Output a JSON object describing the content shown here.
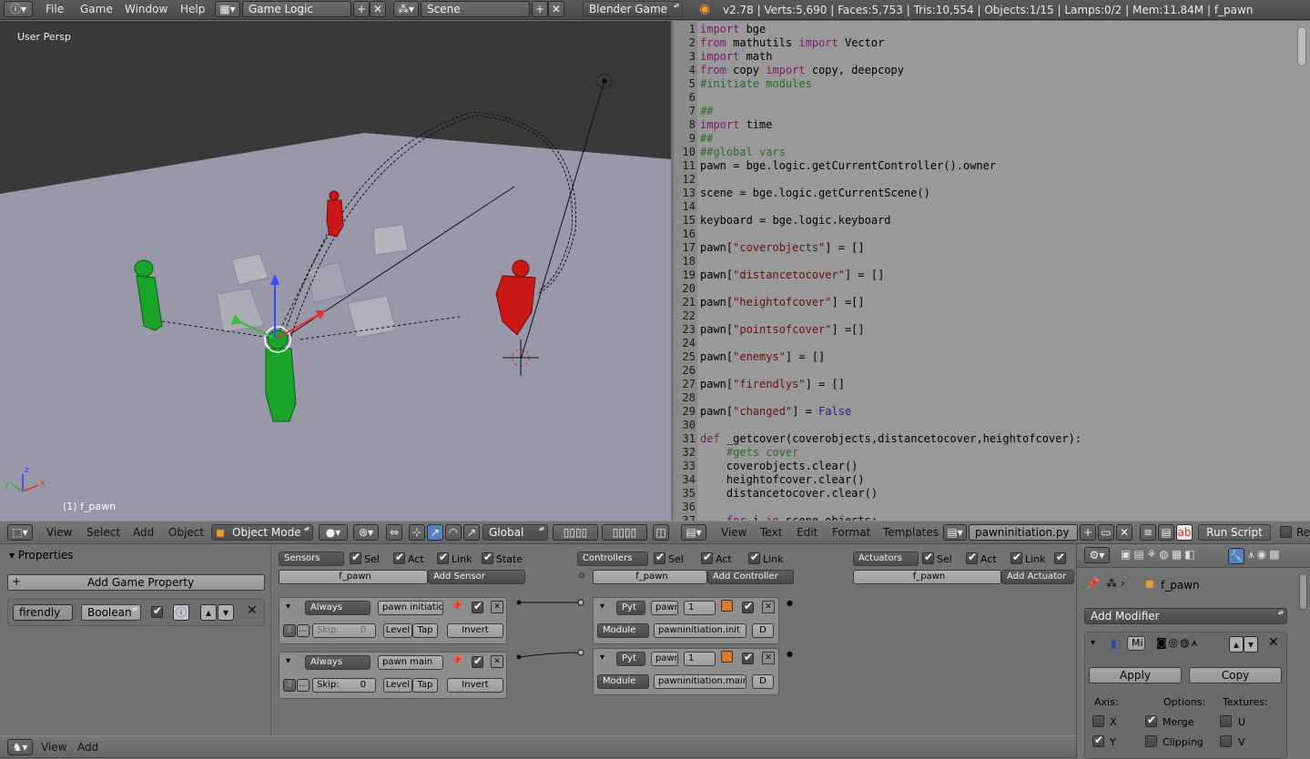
{
  "topbar": {
    "menus": [
      "File",
      "Game",
      "Window",
      "Help"
    ],
    "screen_layout": "Game Logic",
    "scene": "Scene",
    "engine": "Blender Game",
    "status": "v2.78 | Verts:5,690 | Faces:5,753 | Tris:10,554 | Objects:1/15 | Lamps:0/2 | Mem:11.84M | f_pawn"
  },
  "viewport": {
    "view_label": "User Persp",
    "object_label": "(1) f_pawn",
    "axis_labels": {
      "x": "x",
      "y": "y",
      "z": "z"
    },
    "header": {
      "menus": [
        "View",
        "Select",
        "Add",
        "Object"
      ],
      "mode": "Object Mode",
      "orientation": "Global"
    }
  },
  "text_editor": {
    "lines": [
      {
        "n": "1",
        "t": "import bge"
      },
      {
        "n": "2",
        "t": "from mathutils import Vector"
      },
      {
        "n": "3",
        "t": "import math"
      },
      {
        "n": "4",
        "t": "from copy import copy, deepcopy"
      },
      {
        "n": "5",
        "t": "#initiate modules"
      },
      {
        "n": "6",
        "t": ""
      },
      {
        "n": "7",
        "t": "##"
      },
      {
        "n": "8",
        "t": "import time"
      },
      {
        "n": "9",
        "t": "##"
      },
      {
        "n": "10",
        "t": "##global vars"
      },
      {
        "n": "11",
        "t": "pawn = bge.logic.getCurrentController().owner"
      },
      {
        "n": "12",
        "t": ""
      },
      {
        "n": "13",
        "t": "scene = bge.logic.getCurrentScene()"
      },
      {
        "n": "14",
        "t": ""
      },
      {
        "n": "15",
        "t": "keyboard = bge.logic.keyboard"
      },
      {
        "n": "16",
        "t": ""
      },
      {
        "n": "17",
        "t": "pawn[\"coverobjects\"] = []"
      },
      {
        "n": "18",
        "t": ""
      },
      {
        "n": "19",
        "t": "pawn[\"distancetocover\"] = []"
      },
      {
        "n": "20",
        "t": ""
      },
      {
        "n": "21",
        "t": "pawn[\"heightofcover\"] =[]"
      },
      {
        "n": "22",
        "t": ""
      },
      {
        "n": "23",
        "t": "pawn[\"pointsofcover\"] =[]"
      },
      {
        "n": "24",
        "t": ""
      },
      {
        "n": "25",
        "t": "pawn[\"enemys\"] = []"
      },
      {
        "n": "26",
        "t": ""
      },
      {
        "n": "27",
        "t": "pawn[\"firendlys\"] = []"
      },
      {
        "n": "28",
        "t": ""
      },
      {
        "n": "29",
        "t": "pawn[\"changed\"] = False"
      },
      {
        "n": "30",
        "t": ""
      },
      {
        "n": "31",
        "t": "def _getcover(coverobjects,distancetocover,heightofcover):"
      },
      {
        "n": "32",
        "t": "    #gets cover"
      },
      {
        "n": "33",
        "t": "    coverobjects.clear()"
      },
      {
        "n": "34",
        "t": "    heightofcover.clear()"
      },
      {
        "n": "35",
        "t": "    distancetocover.clear()"
      },
      {
        "n": "36",
        "t": ""
      },
      {
        "n": "37",
        "t": "    for i in scene.objects:"
      }
    ],
    "header": {
      "menus": [
        "View",
        "Text",
        "Edit",
        "Format",
        "Templates"
      ],
      "filename": "pawninitiation.py",
      "run_script": "Run Script",
      "trailing": "Re"
    }
  },
  "properties": {
    "title": "Properties",
    "add_button": "Add Game Property",
    "prop_name": "firendly",
    "prop_type": "Boolean"
  },
  "logic": {
    "sensors": {
      "menu": "Sensors",
      "sel": "Sel",
      "act": "Act",
      "link": "Link",
      "state": "State",
      "object": "f_pawn",
      "add": "Add Sensor"
    },
    "controllers": {
      "menu": "Controllers",
      "sel": "Sel",
      "act": "Act",
      "link": "Link",
      "object": "f_pawn",
      "add": "Add Controller"
    },
    "actuators": {
      "menu": "Actuators",
      "sel": "Sel",
      "act": "Act",
      "link": "Link",
      "object": "f_pawn",
      "add": "Add Actuator"
    },
    "sensor_bricks": [
      {
        "type": "Always",
        "name": "pawn initiation",
        "skip_label": "Skip:",
        "skip": "0",
        "level": "Level",
        "tap": "Tap",
        "invert": "Invert"
      },
      {
        "type": "Always",
        "name": "pawn main",
        "skip_label": "Skip:",
        "skip": "0",
        "level": "Level",
        "tap": "Tap",
        "invert": "Invert"
      }
    ],
    "controller_bricks": [
      {
        "type": "Pyt",
        "name": "pawn",
        "priority": "1",
        "mode": "Module",
        "module": "pawninitiation.init",
        "d": "D"
      },
      {
        "type": "Pyt",
        "name": "pawn",
        "priority": "1",
        "mode": "Module",
        "module": "pawninitiation.main",
        "d": "D"
      }
    ],
    "footer": {
      "menus": [
        "View",
        "Add"
      ]
    }
  },
  "modifiers": {
    "object": "f_pawn",
    "add_modifier": "Add Modifier",
    "mod_name": "Mi",
    "apply": "Apply",
    "copy": "Copy",
    "axis_label": "Axis:",
    "options_label": "Options:",
    "textures_label": "Textures:",
    "x": "X",
    "y": "Y",
    "merge": "Merge",
    "clipping": "Clipping",
    "u": "U",
    "v": "V"
  }
}
